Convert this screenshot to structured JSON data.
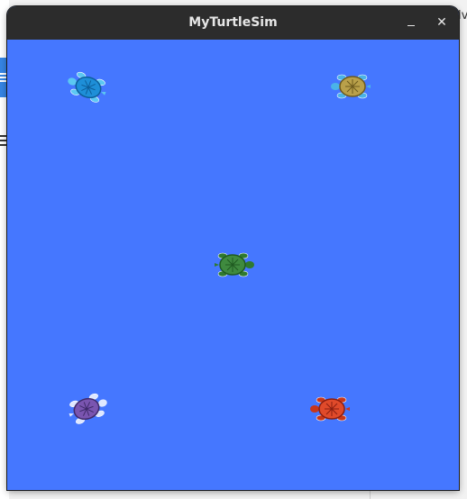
{
  "window": {
    "title": "MyTurtleSim",
    "minimize_icon": "minimize-icon",
    "close_icon": "close-icon",
    "close_glyph": "✕"
  },
  "canvas": {
    "background_color": "#4577ff"
  },
  "turtles": [
    {
      "name": "turtle-cyan",
      "shell": "#1e8fd8",
      "shell_dark": "#0d5e9a",
      "body": "#5cc8f2",
      "heading_deg": 200
    },
    {
      "name": "turtle-yellow",
      "shell": "#b9a04a",
      "shell_dark": "#6d5a1e",
      "body": "#4ab3e8",
      "heading_deg": 180
    },
    {
      "name": "turtle-green",
      "shell": "#3f8a3f",
      "shell_dark": "#1f5a20",
      "body": "#2f7a2f",
      "heading_deg": 0
    },
    {
      "name": "turtle-purple",
      "shell": "#7a55b0",
      "shell_dark": "#3f2a6a",
      "body": "#dfe8ff",
      "heading_deg": -20
    },
    {
      "name": "turtle-red",
      "shell": "#e04a2a",
      "shell_dark": "#8a1e10",
      "body": "#c8361a",
      "heading_deg": 180
    }
  ],
  "background": {
    "right_text": "lv"
  }
}
